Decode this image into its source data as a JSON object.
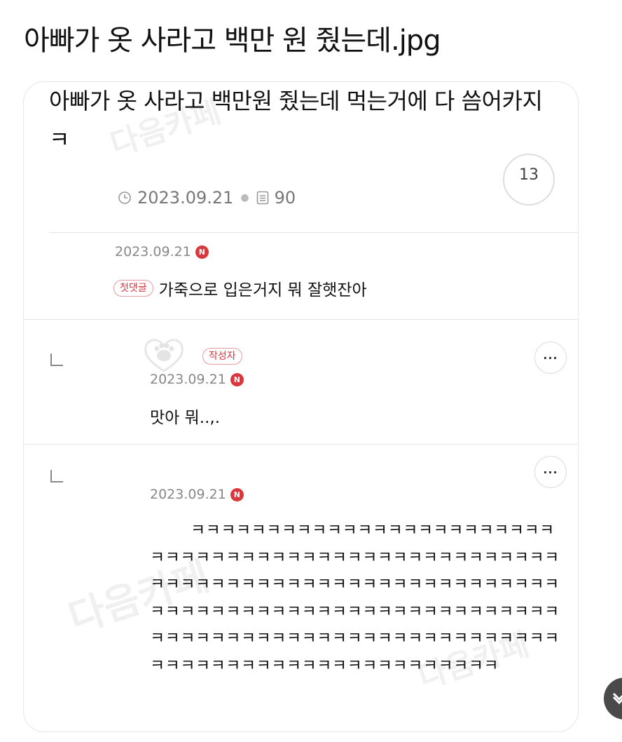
{
  "page_title": "아빠가 옷 사라고 백만 원 줬는데.jpg",
  "post": {
    "title": "아빠가 옷 사라고 백만원 줬는데 먹는거에 다 씀어카지 ㅋ",
    "date": "2023.09.21",
    "views": "90",
    "comment_count": "13"
  },
  "comments": [
    {
      "date": "2023.09.21",
      "new_badge": "N",
      "tag": "첫댓글",
      "text": "가죽으로 입은거지 뭐 잘햇잔아"
    },
    {
      "date": "2023.09.21",
      "new_badge": "N",
      "tag": "작성자",
      "text": "맛아 뭐..,.",
      "more": "···"
    },
    {
      "date": "2023.09.21",
      "new_badge": "N",
      "text": "ㅋㅋㅋㅋㅋㅋㅋㅋㅋㅋㅋㅋㅋㅋㅋㅋㅋㅋㅋㅋㅋㅋㅋㅋㅋㅋㅋㅋㅋㅋㅋㅋㅋㅋㅋㅋㅋㅋㅋㅋㅋㅋㅋㅋㅋㅋㅋㅋㅋㅋㅋㅋㅋㅋㅋㅋㅋㅋㅋㅋㅋㅋㅋㅋㅋㅋㅋㅋㅋㅋㅋㅋㅋㅋㅋㅋㅋㅋㅋㅋㅋㅋㅋㅋㅋㅋㅋㅋㅋㅋㅋㅋㅋㅋㅋㅋㅋㅋㅋㅋㅋㅋㅋㅋㅋㅋㅋㅋㅋㅋㅋㅋㅋㅋㅋㅋㅋㅋㅋㅋㅋㅋㅋㅋㅋㅋㅋㅋㅋㅋㅋㅋㅋㅋㅋㅋㅋㅋㅋㅋㅋㅋㅋㅋㅋㅋㅋㅋㅋㅋㅋㅋㅋㅋㅋ",
      "more": "···"
    }
  ],
  "watermark": "다음카페",
  "colors": {
    "accent_red": "#d9363e",
    "divider": "#e6e6e6"
  }
}
